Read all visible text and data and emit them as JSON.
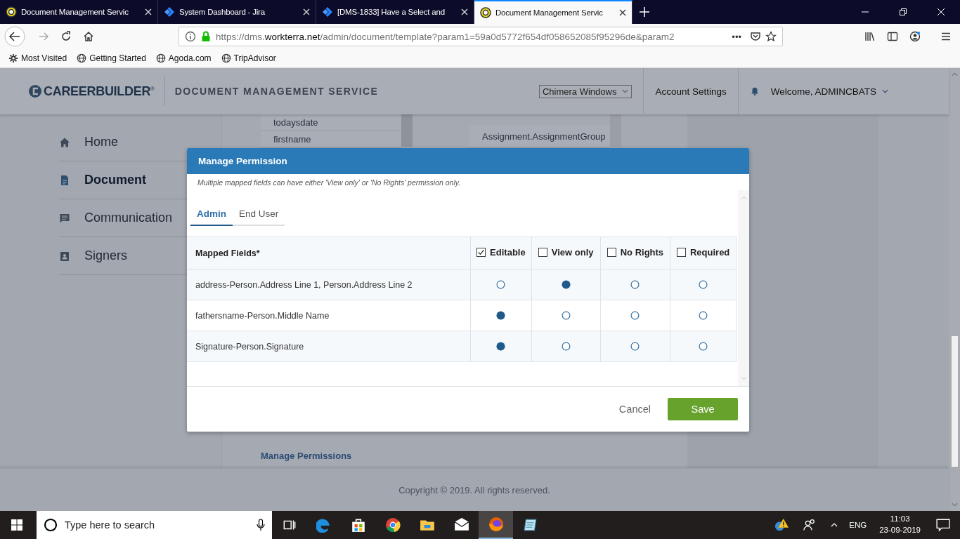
{
  "browser": {
    "tabs": [
      {
        "title": "Document Management Servic",
        "kind": "dms",
        "selected": false
      },
      {
        "title": "System Dashboard - Jira",
        "kind": "jira",
        "selected": false
      },
      {
        "title": "[DMS-1833] Have a Select and",
        "kind": "jira",
        "selected": false
      },
      {
        "title": "Document Management Servic",
        "kind": "dms",
        "selected": true
      }
    ],
    "url": {
      "scheme": "https://dms.",
      "domain": "workterra.net",
      "path": "/admin/document/template?param1=59a0d5772f654df058652085f95296de&param2"
    },
    "more": "•••",
    "bookmarks": [
      {
        "label": "Most Visited",
        "kind": "gear"
      },
      {
        "label": "Getting Started",
        "kind": "globe"
      },
      {
        "label": "Agoda.com",
        "kind": "globe"
      },
      {
        "label": "TripAdvisor",
        "kind": "globe"
      }
    ]
  },
  "header": {
    "logo": "CAREERBUILDER$^{®}$",
    "service": "DOCUMENT MANAGEMENT SERVICE",
    "site_select": "Chimera Windows",
    "account": "Account Settings",
    "welcome": "Welcome, ADMINCBATS"
  },
  "sidebar": {
    "items": [
      {
        "label": "Home",
        "kind": "home",
        "selected": false
      },
      {
        "label": "Document",
        "kind": "doc",
        "selected": true
      },
      {
        "label": "Communication",
        "kind": "chat",
        "selected": false
      },
      {
        "label": "Signers",
        "kind": "badge",
        "selected": false
      }
    ]
  },
  "content": {
    "list_1": [
      "todaysdate",
      "firstname"
    ],
    "list_2": [
      "Assignment.AssignmentGroup"
    ],
    "link": "Manage Permissions"
  },
  "footer": "Copyright © 2019. All rights reserved.",
  "modal": {
    "title": "Manage Permission",
    "note": "Multiple mapped fields can have either 'View only' or 'No Rights' permission only.",
    "tabs": [
      {
        "label": "Admin",
        "selected": true
      },
      {
        "label": "End User",
        "selected": false
      }
    ],
    "field_column": "Mapped Fields*",
    "columns": [
      {
        "label": "Editable",
        "checked": true
      },
      {
        "label": "View only",
        "checked": false
      },
      {
        "label": "No Rights",
        "checked": false
      },
      {
        "label": "Required",
        "checked": false
      }
    ],
    "rows": [
      {
        "field": "address-Person.Address Line 1, Person.Address Line 2",
        "options": [
          {
            "selected": false
          },
          {
            "selected": true
          },
          {
            "selected": false
          },
          {
            "selected": false
          }
        ]
      },
      {
        "field": "fathersname-Person.Middle Name",
        "options": [
          {
            "selected": true
          },
          {
            "selected": false
          },
          {
            "selected": false
          },
          {
            "selected": false
          }
        ]
      },
      {
        "field": "Signature-Person.Signature",
        "options": [
          {
            "selected": true
          },
          {
            "selected": false
          },
          {
            "selected": false
          },
          {
            "selected": false
          }
        ]
      }
    ],
    "cancel": "Cancel",
    "save": "Save"
  },
  "taskbar": {
    "search_placeholder": "Type here to search",
    "apps": [
      {
        "kind": "taskview",
        "active": false
      },
      {
        "kind": "edge",
        "active": false
      },
      {
        "kind": "store",
        "active": false
      },
      {
        "kind": "chrome",
        "active": false
      },
      {
        "kind": "explorer",
        "active": false
      },
      {
        "kind": "mail",
        "active": false
      },
      {
        "kind": "firefox",
        "active": true
      },
      {
        "kind": "notepad",
        "active": false
      }
    ],
    "lang": "ENG",
    "time": "11:03",
    "date": "23-09-2019"
  }
}
